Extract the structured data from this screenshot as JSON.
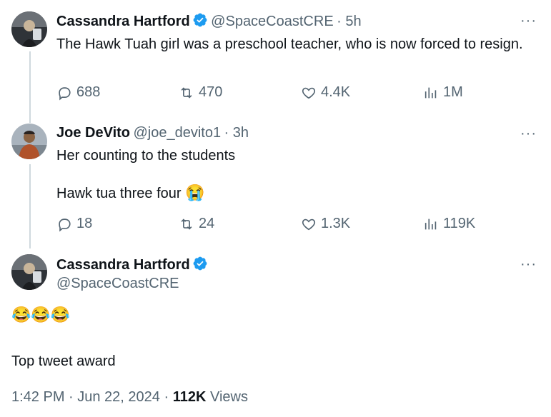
{
  "tweet1": {
    "name": "Cassandra Hartford",
    "handle": "@SpaceCoastCRE",
    "time": "· 5h",
    "text": "The Hawk Tuah girl was a preschool teacher, who is now forced to resign.",
    "replies": "688",
    "retweets": "470",
    "likes": "4.4K",
    "views": "1M"
  },
  "tweet2": {
    "name": "Joe DeVito",
    "handle": "@joe_devito1",
    "time": "· 3h",
    "line1": "Her counting to the students",
    "line2": "Hawk tua three four",
    "line2_emoji": "😭",
    "replies": "18",
    "retweets": "24",
    "likes": "1.3K",
    "views": "119K"
  },
  "main": {
    "name": "Cassandra Hartford",
    "handle": "@SpaceCoastCRE",
    "emoji_line": "😂😂😂",
    "text": "Top tweet award",
    "time_date": "1:42 PM · Jun 22, 2024 ·",
    "views_count": "112K",
    "views_label": "Views"
  },
  "icons": {
    "more": "more-icon",
    "verified": "verified-badge-icon",
    "reply": "reply-icon",
    "retweet": "retweet-icon",
    "like": "heart-icon",
    "views": "analytics-icon"
  },
  "colors": {
    "verified": "#1d9bf0",
    "secondary_text": "#536471",
    "thread_line": "#cfd9de"
  },
  "more_label": "···"
}
